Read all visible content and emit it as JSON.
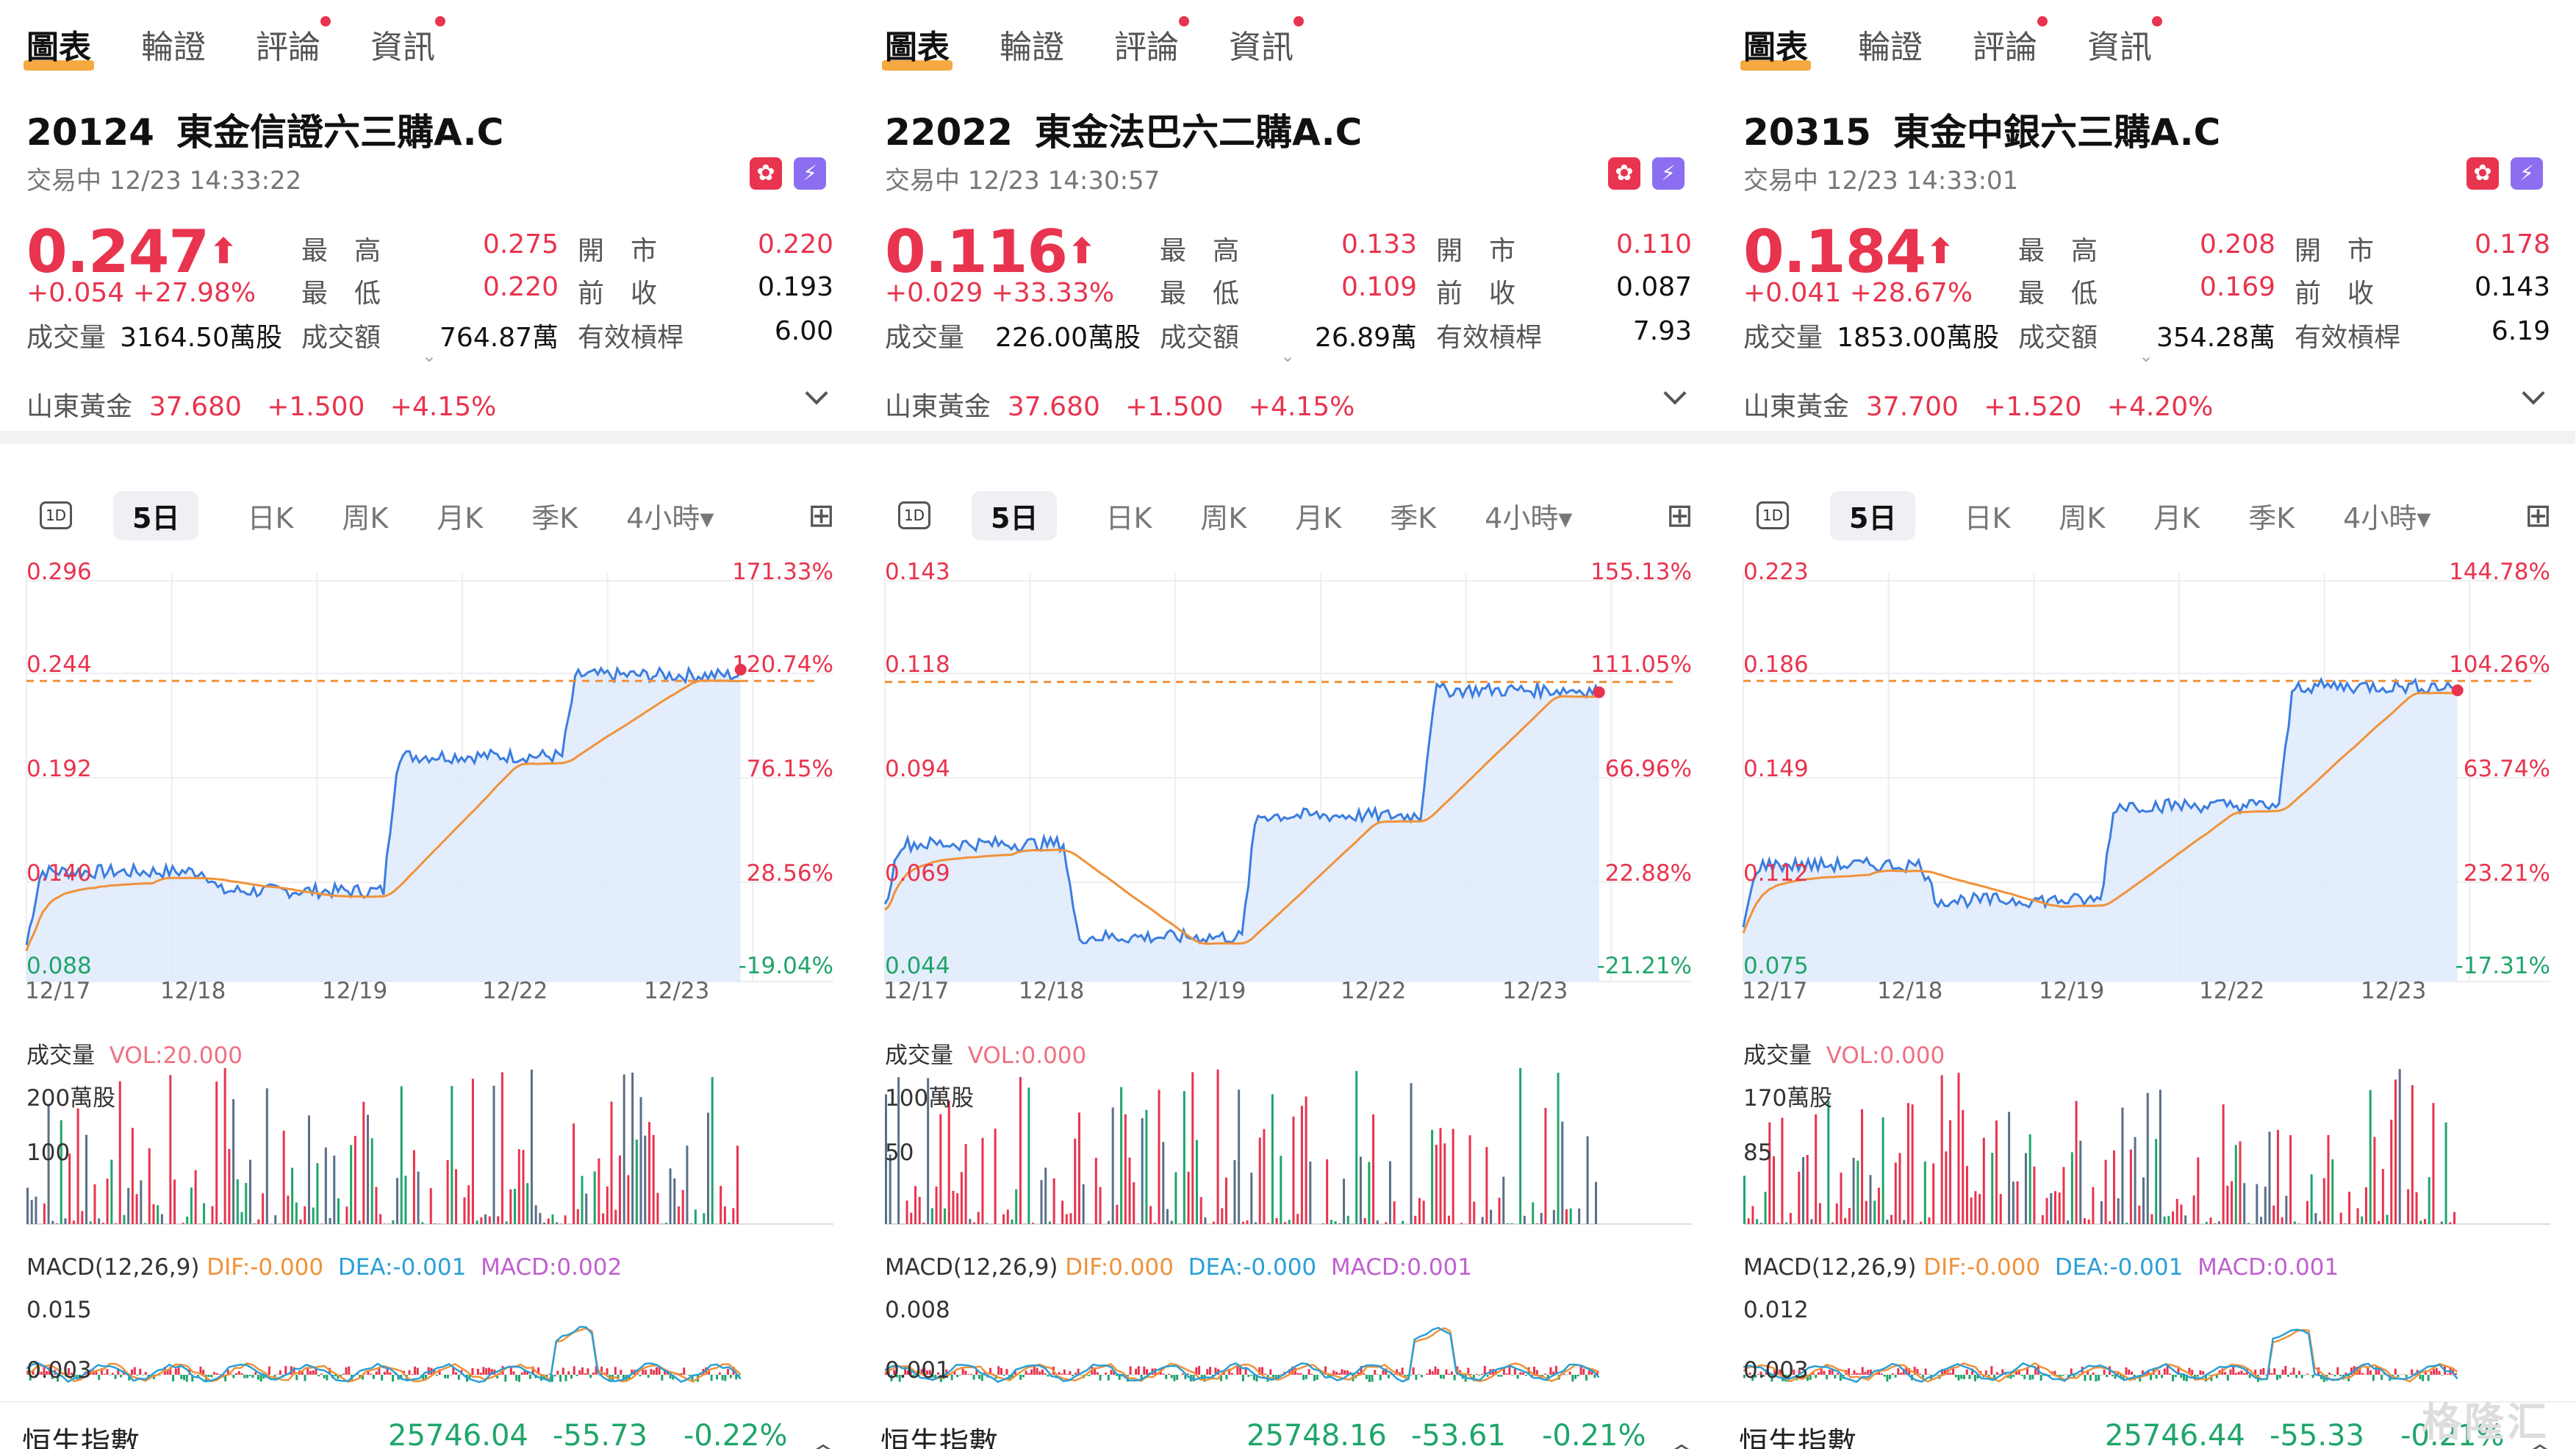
{
  "nav": {
    "tabs": [
      "圖表",
      "輪證",
      "評論",
      "資訊"
    ]
  },
  "panels": [
    {
      "code": "20124",
      "name": "東金信證六三購A.C",
      "status": "交易中 12/23 14:33:22",
      "price": "0.247",
      "change": "+0.054",
      "change_pct": "+27.98%",
      "high_label": "最　高",
      "high": "0.275",
      "open_label": "開　市",
      "open": "0.220",
      "low_label": "最　低",
      "low": "0.220",
      "prev_label": "前　收",
      "prev": "0.193",
      "volume_label": "成交量",
      "volume": "3164.50萬股",
      "turnover_label": "成交額",
      "turnover": "764.87萬",
      "lev_label": "有效槓桿",
      "leverage": "6.00",
      "underlying_name": "山東黃金",
      "underlying_price": "37.680",
      "underlying_chg": "+1.500",
      "underlying_pct": "+4.15%",
      "y_left": [
        "0.296",
        "0.244",
        "0.192",
        "0.140",
        "0.088"
      ],
      "y_right": [
        "171.33%",
        "120.74%",
        "76.15%",
        "28.56%",
        "-19.04%"
      ],
      "dates": [
        "12/17",
        "12/18",
        "12/19",
        "12/22",
        "12/23"
      ],
      "vol_label": "成交量",
      "vol_value": "VOL:20.000",
      "vol_max": "200萬股",
      "vol_mid": "100",
      "macd_label": "MACD(12,26,9)",
      "dif": "DIF:-0.000",
      "dea": "DEA:-0.001",
      "macd": "MACD:0.002",
      "macd_top": "0.015",
      "macd_mid": "0.003",
      "index_name": "恒生指數",
      "index_value": "25746.04",
      "index_chg": "-55.73",
      "index_pct": "-0.22%"
    },
    {
      "code": "22022",
      "name": "東金法巴六二購A.C",
      "status": "交易中 12/23 14:30:57",
      "price": "0.116",
      "change": "+0.029",
      "change_pct": "+33.33%",
      "high_label": "最　高",
      "high": "0.133",
      "open_label": "開　市",
      "open": "0.110",
      "low_label": "最　低",
      "low": "0.109",
      "prev_label": "前　收",
      "prev": "0.087",
      "volume_label": "成交量",
      "volume": "226.00萬股",
      "turnover_label": "成交額",
      "turnover": "26.89萬",
      "lev_label": "有效槓桿",
      "leverage": "7.93",
      "underlying_name": "山東黃金",
      "underlying_price": "37.680",
      "underlying_chg": "+1.500",
      "underlying_pct": "+4.15%",
      "y_left": [
        "0.143",
        "0.118",
        "0.094",
        "0.069",
        "0.044"
      ],
      "y_right": [
        "155.13%",
        "111.05%",
        "66.96%",
        "22.88%",
        "-21.21%"
      ],
      "dates": [
        "12/17",
        "12/18",
        "12/19",
        "12/22",
        "12/23"
      ],
      "vol_label": "成交量",
      "vol_value": "VOL:0.000",
      "vol_max": "100萬股",
      "vol_mid": "50",
      "macd_label": "MACD(12,26,9)",
      "dif": "DIF:0.000",
      "dea": "DEA:-0.000",
      "macd": "MACD:0.001",
      "macd_top": "0.008",
      "macd_mid": "0.001",
      "index_name": "恒生指數",
      "index_value": "25748.16",
      "index_chg": "-53.61",
      "index_pct": "-0.21%"
    },
    {
      "code": "20315",
      "name": "東金中銀六三購A.C",
      "status": "交易中 12/23 14:33:01",
      "price": "0.184",
      "change": "+0.041",
      "change_pct": "+28.67%",
      "high_label": "最　高",
      "high": "0.208",
      "open_label": "開　市",
      "open": "0.178",
      "low_label": "最　低",
      "low": "0.169",
      "prev_label": "前　收",
      "prev": "0.143",
      "volume_label": "成交量",
      "volume": "1853.00萬股",
      "turnover_label": "成交額",
      "turnover": "354.28萬",
      "lev_label": "有效槓桿",
      "leverage": "6.19",
      "underlying_name": "山東黃金",
      "underlying_price": "37.700",
      "underlying_chg": "+1.520",
      "underlying_pct": "+4.20%",
      "y_left": [
        "0.223",
        "0.186",
        "0.149",
        "0.112",
        "0.075"
      ],
      "y_right": [
        "144.78%",
        "104.26%",
        "63.74%",
        "23.21%",
        "-17.31%"
      ],
      "dates": [
        "12/17",
        "12/18",
        "12/19",
        "12/22",
        "12/23"
      ],
      "vol_label": "成交量",
      "vol_value": "VOL:0.000",
      "vol_max": "170萬股",
      "vol_mid": "85",
      "macd_label": "MACD(12,26,9)",
      "dif": "DIF:-0.000",
      "dea": "DEA:-0.001",
      "macd": "MACD:0.001",
      "macd_top": "0.012",
      "macd_mid": "0.003",
      "index_name": "恒生指數",
      "index_value": "25746.44",
      "index_chg": "-55.33",
      "index_pct": "-0.21%"
    }
  ],
  "periods": [
    "1D",
    "5日",
    "日K",
    "周K",
    "月K",
    "季K",
    "4小時▾"
  ],
  "watermark": "格隆汇",
  "colors": {
    "up": "#e8344e",
    "down": "#1fa56a",
    "line": "#3b7de0",
    "avg": "#f0923a",
    "fill": "#dde8fb"
  },
  "chart_data": [
    {
      "type": "line",
      "title": "",
      "x": [
        "12/17",
        "12/18",
        "12/19",
        "12/22",
        "12/23"
      ],
      "series": [
        {
          "values": [
            0.107,
            0.145,
            0.135,
            0.205,
            0.247
          ]
        }
      ],
      "ylim": [
        0.088,
        0.296
      ],
      "ref_line": 0.244
    },
    {
      "type": "line",
      "title": "",
      "x": [
        "12/17",
        "12/18",
        "12/19",
        "12/22",
        "12/23"
      ],
      "series": [
        {
          "values": [
            0.062,
            0.078,
            0.055,
            0.085,
            0.116
          ]
        }
      ],
      "ylim": [
        0.044,
        0.143
      ],
      "ref_line": 0.118
    },
    {
      "type": "line",
      "title": "",
      "x": [
        "12/17",
        "12/18",
        "12/19",
        "12/22",
        "12/23"
      ],
      "series": [
        {
          "values": [
            0.095,
            0.118,
            0.105,
            0.14,
            0.184
          ]
        }
      ],
      "ylim": [
        0.075,
        0.223
      ],
      "ref_line": 0.186
    }
  ]
}
